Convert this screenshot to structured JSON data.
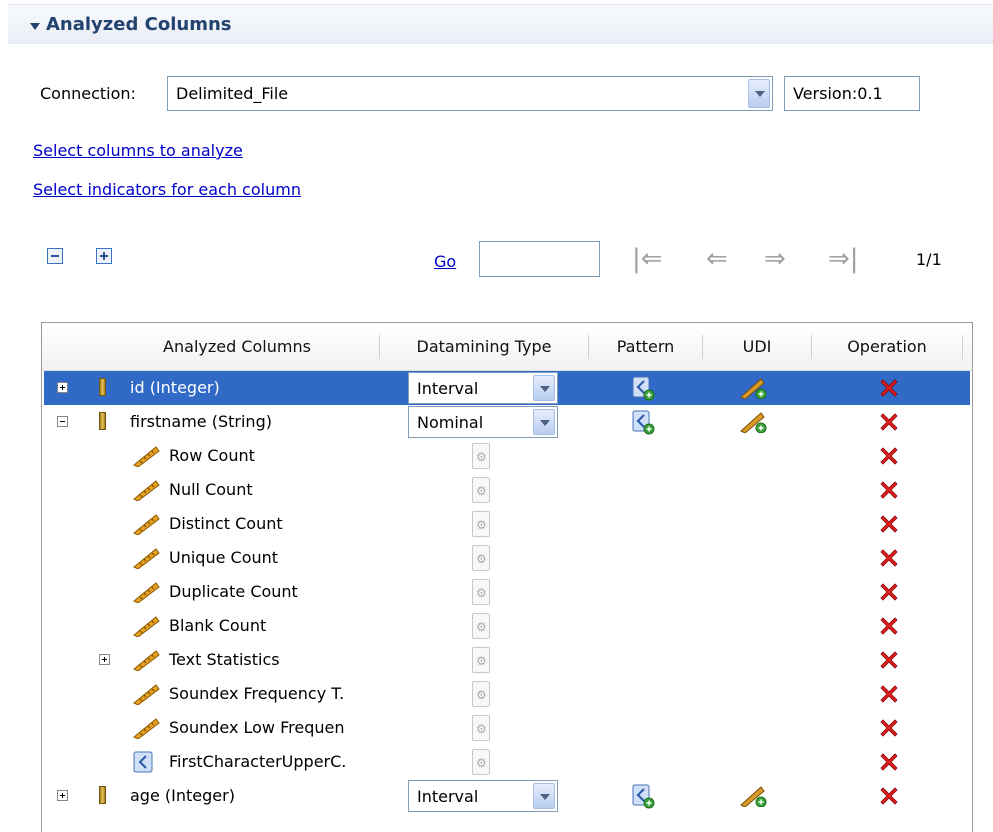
{
  "section": {
    "title": "Analyzed Columns"
  },
  "connection": {
    "label": "Connection:",
    "value": "Delimited_File",
    "version": "Version:0.1"
  },
  "links": {
    "select_columns": "Select columns to analyze",
    "select_indicators": "Select indicators for each column"
  },
  "paging": {
    "go_label": "Go",
    "go_value": "",
    "page_indicator": "1/1"
  },
  "table": {
    "headers": [
      "Analyzed Columns",
      "Datamining Type",
      "Pattern",
      "UDI",
      "Operation"
    ],
    "rows": [
      {
        "label": "id (Integer)",
        "type": "Interval"
      },
      {
        "label": "firstname (String)",
        "type": "Nominal"
      },
      {
        "label": "Row Count"
      },
      {
        "label": "Null Count"
      },
      {
        "label": "Distinct Count"
      },
      {
        "label": "Unique Count"
      },
      {
        "label": "Duplicate Count"
      },
      {
        "label": "Blank Count"
      },
      {
        "label": "Text Statistics"
      },
      {
        "label": "Soundex Frequency T."
      },
      {
        "label": "Soundex Low Frequen"
      },
      {
        "label": "FirstCharacterUpperC."
      },
      {
        "label": "age (Integer)",
        "type": "Interval"
      }
    ]
  },
  "colors": {
    "header_text": "#23436f",
    "link": "#0000cc",
    "selection": "#3169c6",
    "delete": "#e02020"
  }
}
